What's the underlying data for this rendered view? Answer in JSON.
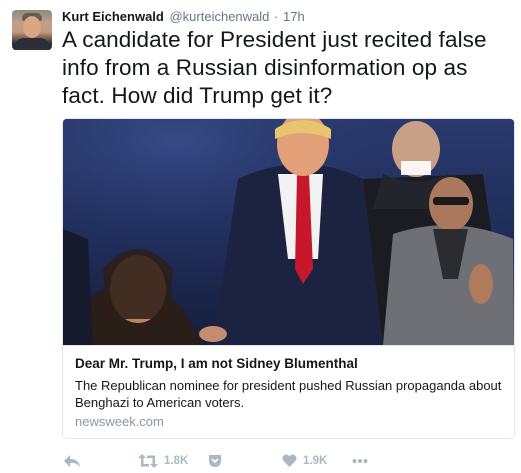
{
  "tweet": {
    "author_name": "Kurt Eichenwald",
    "author_handle": "@kurteichenwald",
    "separator": "·",
    "time": "17h",
    "text": "A candidate for President just recited false info from a Russian disinformation op as fact. How did Trump get it?"
  },
  "card": {
    "title": "Dear Mr. Trump, I am not Sidney Blumenthal",
    "description": "The Republican nominee for president pushed Russian propaganda about Benghazi to American voters.",
    "domain": "newsweek.com"
  },
  "actions": {
    "reply_icon": "reply-icon",
    "retweet_icon": "retweet-icon",
    "retweet_count": "1.8K",
    "save_icon": "pocket-icon",
    "like_icon": "heart-icon",
    "like_count": "1.9K",
    "more_icon": "more-icon"
  },
  "colors": {
    "text": "#14171a",
    "muted": "#657786",
    "action_gray": "#aab8c2",
    "border": "#e1e8ed"
  }
}
